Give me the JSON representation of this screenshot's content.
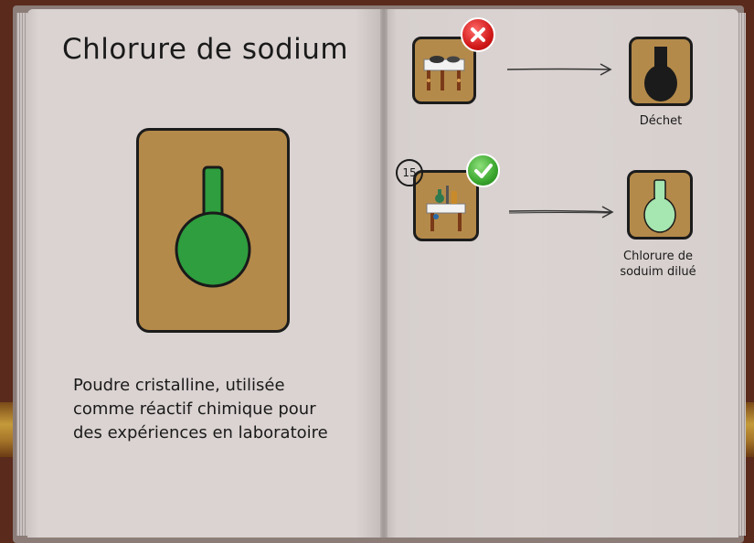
{
  "item": {
    "title": "Chlorure de sodium",
    "description_lines": [
      "Poudre cristalline, utilisée",
      "comme réactif chimique pour",
      "des expériences en laboratoire"
    ],
    "flask_color": "#2e9e3e",
    "card_color": "#b48a4a"
  },
  "recipes": [
    {
      "station_icon": "stove-icon",
      "status": "invalid",
      "status_icon": "close-icon",
      "result_label": "Déchet",
      "result_flask_color": "#1b1b1b"
    },
    {
      "station_icon": "lab-table-icon",
      "status": "valid",
      "status_icon": "check-icon",
      "count": "15",
      "result_label_lines": [
        "Chlorure de",
        "soduim dilué"
      ],
      "result_flask_color": "#a6e6b0"
    }
  ]
}
